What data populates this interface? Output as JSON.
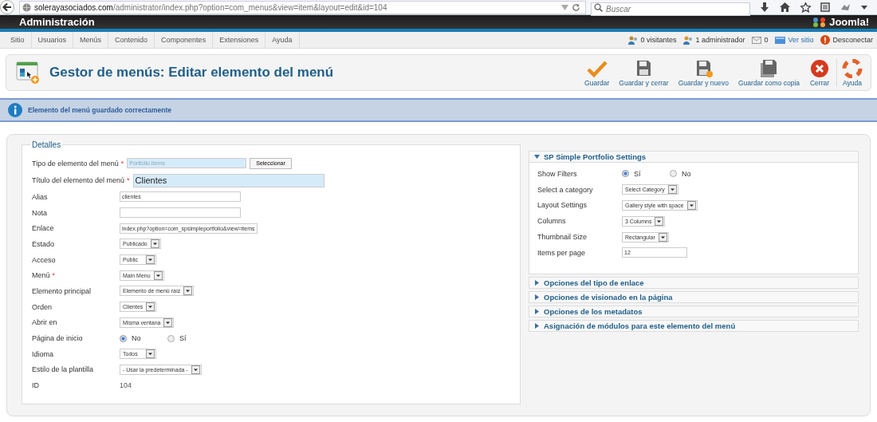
{
  "browser": {
    "url": "**solerayasociados.com**/administrator/index.php?option=com_menus&view=item&layout=edit&id=104",
    "search_placeholder": "Buscar"
  },
  "header": {
    "title": "Administración",
    "logo_text": "Joomla!"
  },
  "menu": [
    "Sitio",
    "Usuarios",
    "Menús",
    "Contenido",
    "Componentes",
    "Extensiones",
    "Ayuda"
  ],
  "status": [
    {
      "kind": "visitors",
      "text": "0 visitantes"
    },
    {
      "kind": "admins",
      "text": "1 administrador"
    },
    {
      "kind": "messages",
      "text": "0"
    },
    {
      "kind": "site",
      "text": "Ver sitio"
    },
    {
      "kind": "logout",
      "text": "Desconectar"
    }
  ],
  "toolbar": {
    "title": "Gestor de menús: Editar elemento del menú",
    "buttons": [
      {
        "kind": "save",
        "label": "Guardar"
      },
      {
        "kind": "save-close",
        "label": "Guardar y cerrar"
      },
      {
        "kind": "save-new",
        "label": "Guardar y nuevo"
      },
      {
        "kind": "save-copy",
        "label": "Guardar como copia"
      },
      {
        "kind": "close",
        "label": "Cerrar"
      },
      {
        "kind": "help",
        "label": "Ayuda"
      }
    ]
  },
  "message": "Elemento del menú guardado correctamente",
  "details": {
    "legend": "Detalles",
    "fields": [
      {
        "kind": "type",
        "label": "Tipo de elemento del menú",
        "mark": "*",
        "value": "Portfolio Items",
        "button": "Seleccionar"
      },
      {
        "kind": "title",
        "label": "Título del elemento del menú",
        "mark": "*",
        "value": "Clientes"
      },
      {
        "kind": "text",
        "label": "Alias",
        "value": "clientes"
      },
      {
        "kind": "text",
        "label": "Nota"
      },
      {
        "kind": "text",
        "label": "Enlace",
        "value": "index.php?option=com_spsimpleportfolio&view=items"
      },
      {
        "kind": "select",
        "label": "Estado",
        "value": "Publicado"
      },
      {
        "kind": "select",
        "label": "Acceso",
        "value": "Public"
      },
      {
        "kind": "select",
        "label": "Menú",
        "mark": "*",
        "value": "Main Menu"
      },
      {
        "kind": "select",
        "label": "Elemento principal",
        "value": "Elemento de menú raíz"
      },
      {
        "kind": "select",
        "label": "Orden",
        "value": "Clientes"
      },
      {
        "kind": "select",
        "label": "Abrir en",
        "value": "Misma ventana"
      },
      {
        "kind": "radio",
        "label": "Página de inicio",
        "options": [
          {
            "label": "No",
            "selected": true
          },
          {
            "label": "Sí",
            "selected": false
          }
        ]
      },
      {
        "kind": "select",
        "label": "Idioma",
        "value": "Todos"
      },
      {
        "kind": "select",
        "label": "Estilo de la plantilla",
        "value": "- Usar la predeterminada -"
      },
      {
        "kind": "static",
        "label": "ID",
        "value": "104"
      }
    ]
  },
  "panels": [
    {
      "title": "SP Simple Portfolio Settings",
      "expanded": true,
      "fields": [
        {
          "kind": "radio",
          "label": "Show Filters",
          "options": [
            {
              "label": "Sí",
              "selected": true
            },
            {
              "label": "No",
              "selected": false
            }
          ]
        },
        {
          "kind": "select",
          "label": "Select a category",
          "value": "Select Category"
        },
        {
          "kind": "select",
          "label": "Layout Settings",
          "value": "Gallery style with space"
        },
        {
          "kind": "select",
          "label": "Columns",
          "value": "3 Columns"
        },
        {
          "kind": "select",
          "label": "Thumbnail Size",
          "value": "Rectangular"
        },
        {
          "kind": "text",
          "label": "Items per page",
          "value": "12"
        }
      ]
    },
    {
      "title": "Opciones del tipo de enlace",
      "expanded": false
    },
    {
      "title": "Opciones de visionado en la página",
      "expanded": false
    },
    {
      "title": "Opciones de los metadatos",
      "expanded": false
    },
    {
      "title": "Asignación de módulos para este elemento del menú",
      "expanded": false
    }
  ]
}
